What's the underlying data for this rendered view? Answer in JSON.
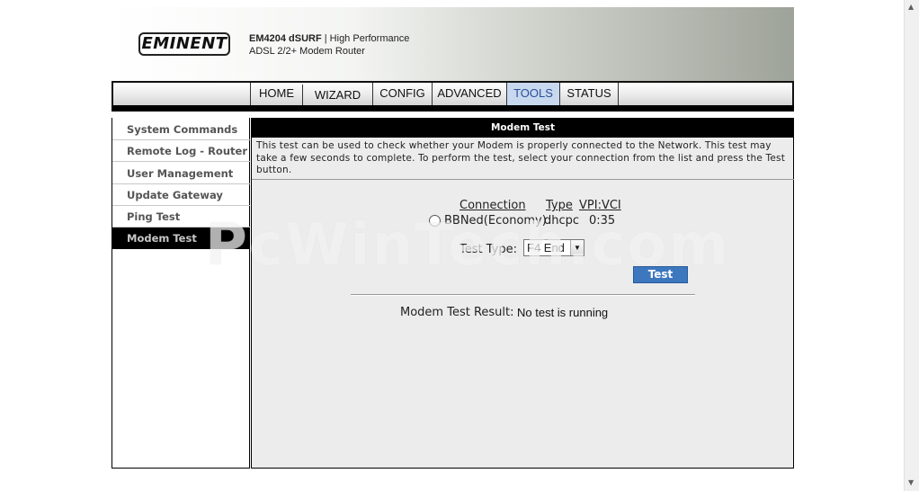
{
  "header": {
    "logo_text": "EMINENT",
    "product_model": "EM4204 dSURF",
    "product_tagline": "| High Performance",
    "product_line2": "ADSL 2/2+ Modem Router"
  },
  "nav": {
    "tabs": [
      {
        "label": "HOME"
      },
      {
        "label": "WIZARD"
      },
      {
        "label": "CONFIG"
      },
      {
        "label": "ADVANCED"
      },
      {
        "label": "TOOLS",
        "active": true
      },
      {
        "label": "STATUS"
      }
    ]
  },
  "sidebar": {
    "items": [
      {
        "label": "System Commands"
      },
      {
        "label": "Remote Log - Router"
      },
      {
        "label": "User Management"
      },
      {
        "label": "Update Gateway"
      },
      {
        "label": "Ping Test"
      },
      {
        "label": "Modem Test",
        "active": true
      }
    ]
  },
  "main": {
    "title": "Modem Test",
    "description": "This test can be used to check whether your Modem is properly connected to the Network. This test may take a few seconds to complete. To perform the test, select your connection from the list and press the Test button.",
    "table": {
      "headers": [
        "Connection",
        "Type",
        "VPI:VCI"
      ],
      "rows": [
        {
          "connection": "BBNed(Economy)",
          "type": "dhcpc",
          "vpivci": "0:35"
        }
      ]
    },
    "test_type_label": "Test Type:",
    "test_type_value": "F4 End",
    "test_button": "Test",
    "result_label": "Modem Test Result:",
    "result_value": "No test is running"
  },
  "watermark": "PcWinTech.com",
  "colors": {
    "active_tab_bg": "#c8d8ee",
    "active_tab_text": "#2a4e9a",
    "button_blue": "#3d78bf",
    "title_bar": "#000000"
  }
}
